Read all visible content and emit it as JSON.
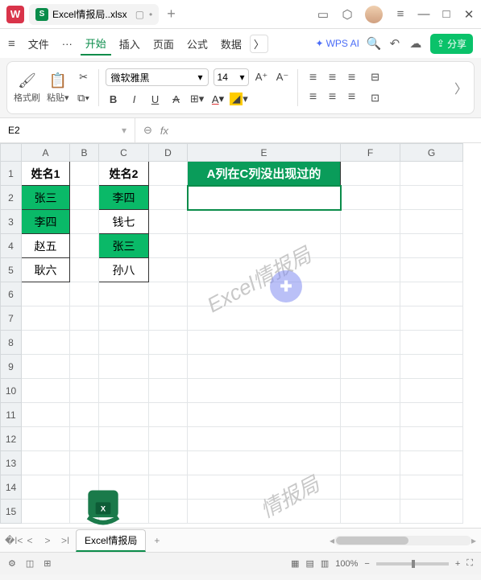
{
  "titlebar": {
    "app_logo": "W",
    "tab_icon": "S",
    "tab_label": "Excel情报局..xlsx",
    "close_tab": "▢",
    "add_tab": "+"
  },
  "menu": {
    "file": "文件",
    "dots": "···",
    "start": "开始",
    "insert": "插入",
    "page": "页面",
    "formula": "公式",
    "data": "数据",
    "more": "〉",
    "ai": "WPS AI",
    "share": "分享"
  },
  "ribbon": {
    "format_painter": "格式刷",
    "paste": "粘贴",
    "font_name": "微软雅黑",
    "font_size": "14",
    "bold": "B",
    "italic": "I",
    "underline": "U",
    "strike": "A"
  },
  "cellref": {
    "name": "E2",
    "fx": "fx"
  },
  "columns": [
    "A",
    "B",
    "C",
    "D",
    "E",
    "F",
    "G"
  ],
  "rows": [
    "1",
    "2",
    "3",
    "4",
    "5",
    "6",
    "7",
    "8",
    "9",
    "10",
    "11",
    "12",
    "13",
    "14",
    "15"
  ],
  "cells": {
    "a1": "姓名1",
    "c1": "姓名2",
    "e1": "A列在C列没出现过的",
    "a2": "张三",
    "c2": "李四",
    "a3": "李四",
    "c3": "钱七",
    "a4": "赵五",
    "c4": "张三",
    "a5": "耿六",
    "c5": "孙八"
  },
  "watermark1": "Excel情报局",
  "watermark2": "情报局",
  "sheet_tab": "Excel情报局",
  "add_sheet": "+",
  "status": {
    "zoom": "100%",
    "minus": "−",
    "plus": "+"
  }
}
